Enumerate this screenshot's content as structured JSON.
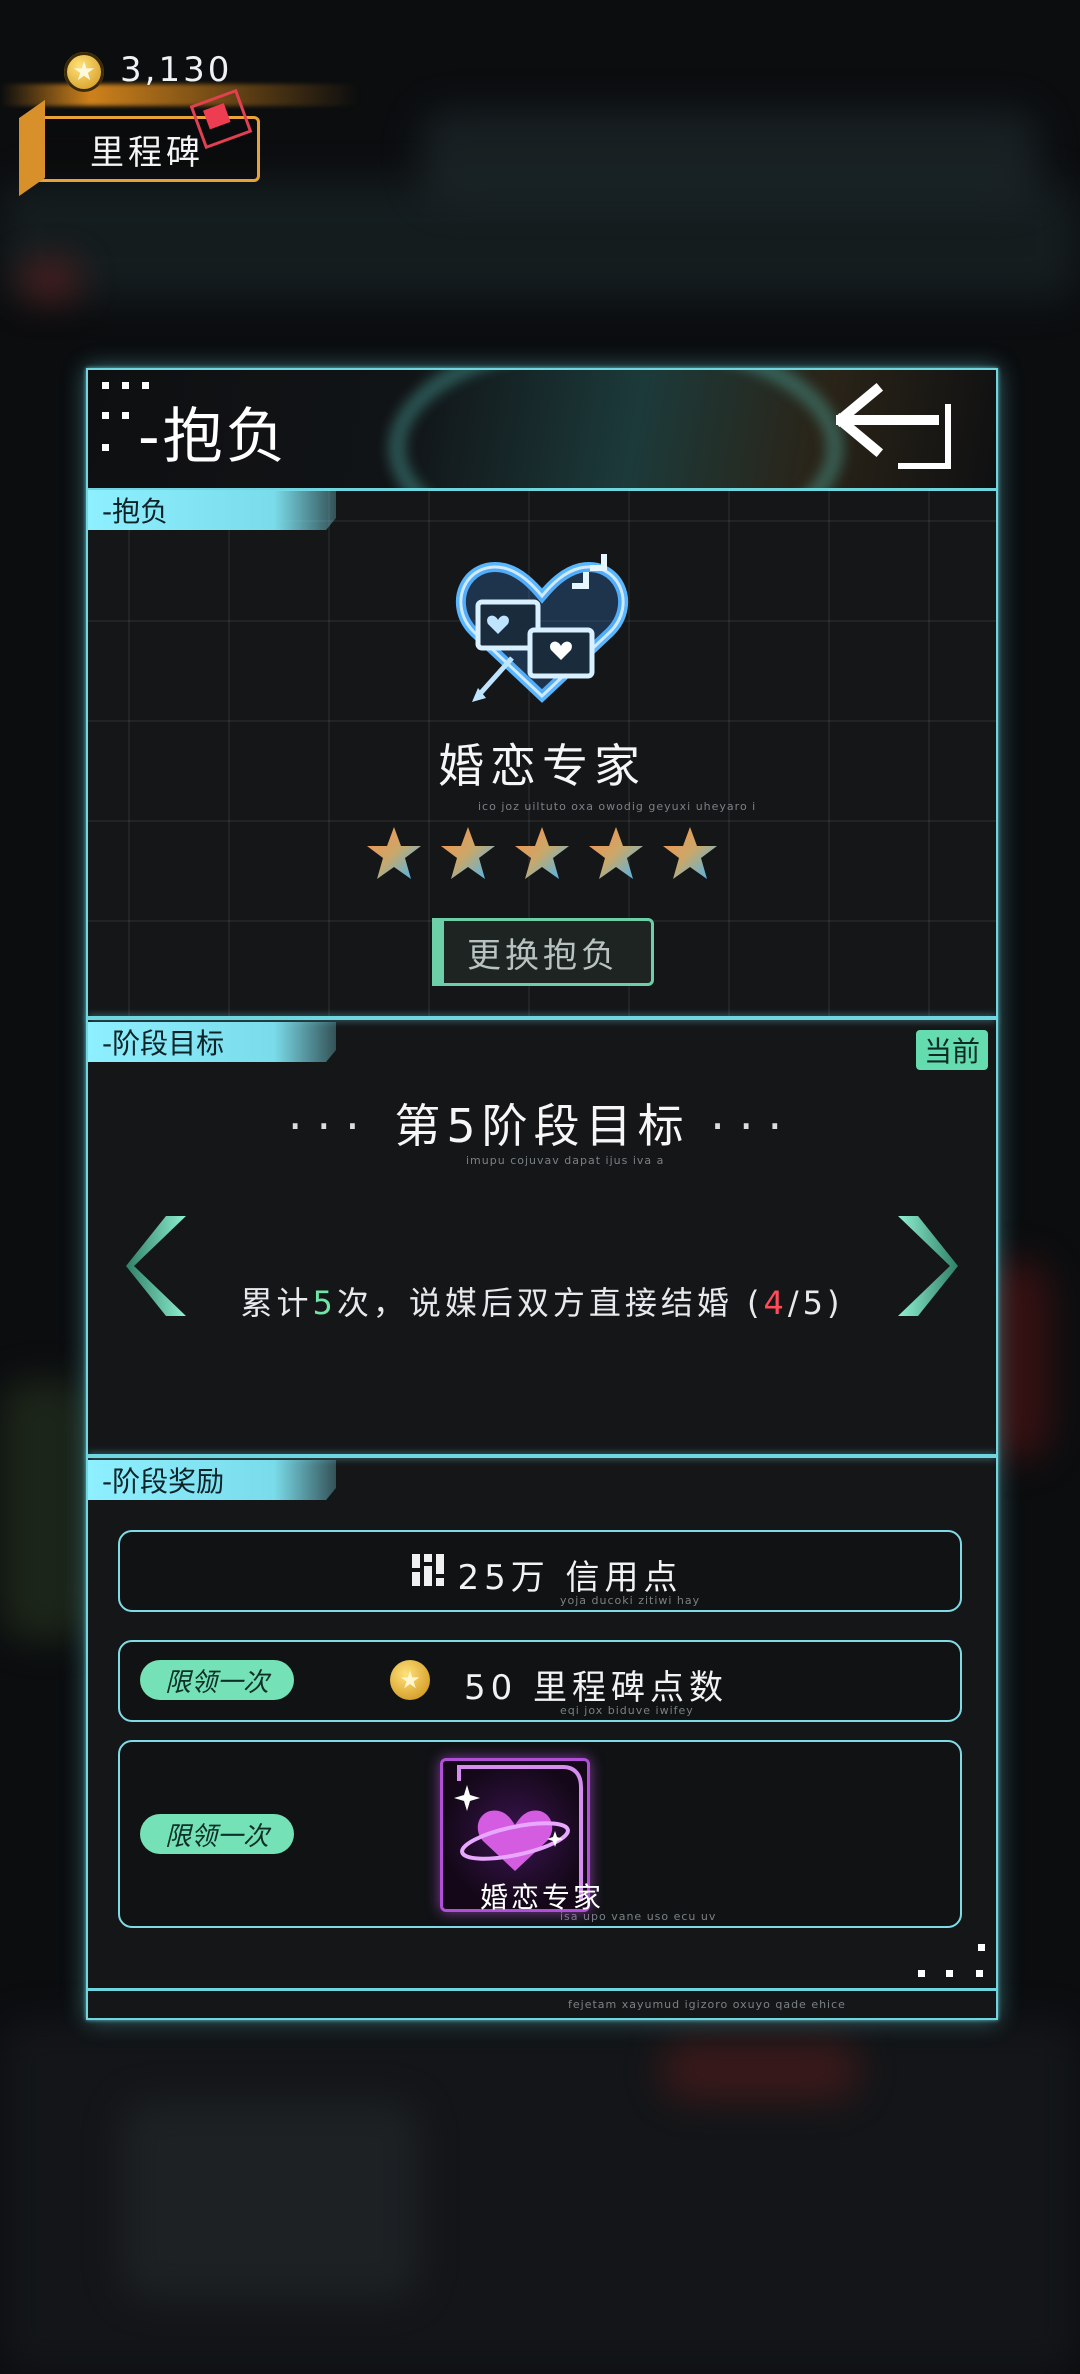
{
  "hud": {
    "coin_value": "3,130",
    "milestone_label": "里程碑"
  },
  "panel": {
    "title": "-抱负"
  },
  "aspiration": {
    "tab": "-抱负",
    "name": "婚恋专家",
    "name_sub": "ico joz uiltuto oxa owodig geyuxi uheyaro i",
    "stars": 5,
    "change_button": "更换抱负"
  },
  "stage": {
    "tab": "-阶段目标",
    "current_badge": "当前",
    "title": "第5阶段目标",
    "title_sub": "imupu cojuvav dapat ijus iva a",
    "goal_prefix": "累计",
    "goal_count": "5",
    "goal_middle": "次，说媒后双方直接结婚 (",
    "progress_current": "4",
    "progress_sep": "/5)"
  },
  "rewards": {
    "tab": "-阶段奖励",
    "items": [
      {
        "text": "25万 信用点",
        "sub": "yoja ducoki zitiwi hay"
      },
      {
        "tag": "限领一次",
        "text": "50 里程碑点数",
        "sub": "eqi jox biduve iwifey"
      },
      {
        "tag": "限领一次",
        "text": "婚恋专家",
        "sub": "isa upo vane uso ecu uv"
      }
    ]
  },
  "footer_sub": "fejetam xayumud igizoro oxuyo qade ehice",
  "colors": {
    "accent": "#6fd6e0",
    "tag_green": "#74e2b6",
    "error_red": "#ff4b5a"
  }
}
